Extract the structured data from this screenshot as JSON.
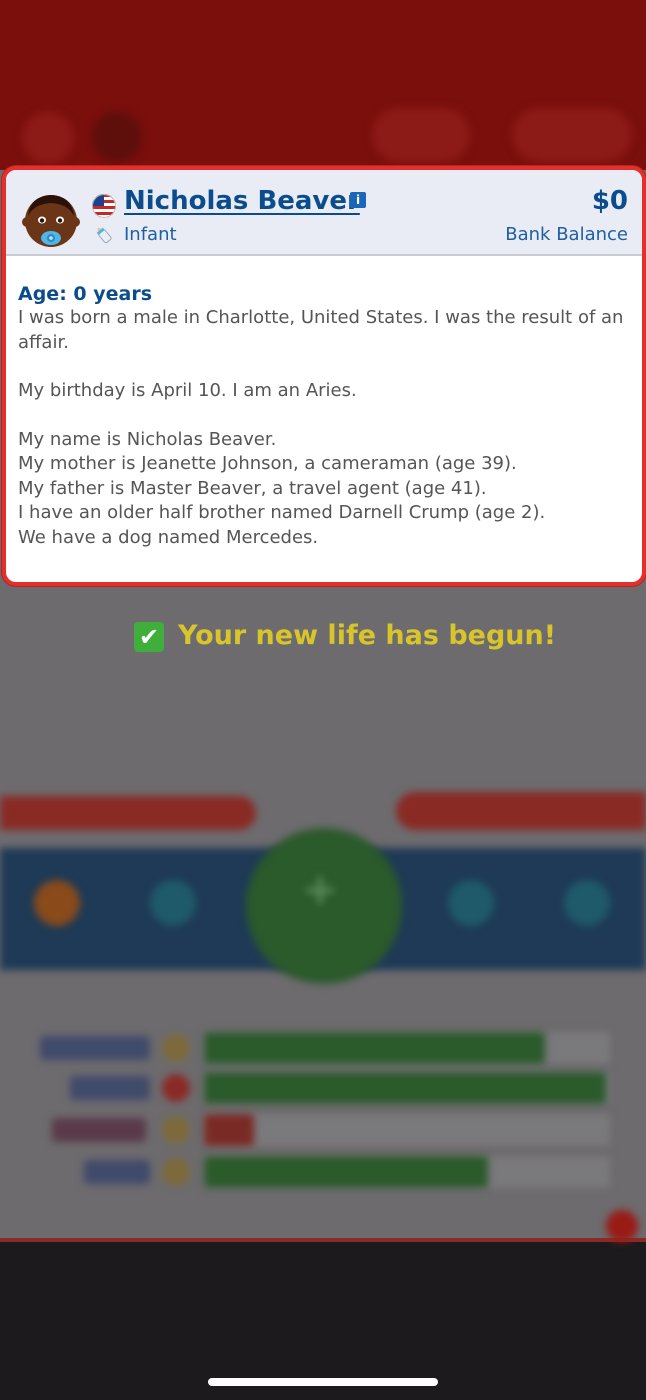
{
  "profile": {
    "name": "Nicholas Beaver",
    "life_stage": "Infant",
    "bank_amount": "$0",
    "bank_label": "Bank Balance",
    "info_badge": "i"
  },
  "bio": {
    "age_heading": "Age: 0 years",
    "lines": [
      "I was born a male in Charlotte, United States. I was the result of an",
      "affair.",
      "",
      "My birthday is April 10. I am an Aries.",
      "",
      "My name is Nicholas Beaver.",
      "My mother is Jeanette Johnson, a cameraman (age 39).",
      "My father is Master Beaver, a travel agent (age 41).",
      "I have an older half brother named Darnell Crump (age 2).",
      "We have a dog named Mercedes."
    ]
  },
  "toast": {
    "check": "✔",
    "text": "Your new life has begun!"
  },
  "background": {
    "stat_levels": [
      0.84,
      0.99,
      0.12,
      0.7
    ],
    "age_button_icon": "+"
  },
  "colors": {
    "card_border": "#e3302c",
    "name_blue": "#0b4d8c",
    "toast_yellow": "#d8c52c",
    "check_green": "#3fae3b"
  },
  "icons": [
    "baby-avatar-icon",
    "us-flag-icon",
    "baby-bottle-icon",
    "info-icon",
    "checkmark-icon"
  ]
}
